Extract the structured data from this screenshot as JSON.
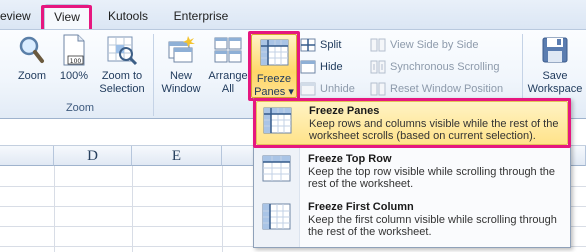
{
  "tabs": [
    {
      "label": "eview",
      "active": false
    },
    {
      "label": "View",
      "active": true
    },
    {
      "label": "Kutools",
      "active": false
    },
    {
      "label": "Enterprise",
      "active": false
    }
  ],
  "ribbon": {
    "zoom_group": {
      "label": "Zoom",
      "buttons": [
        {
          "label": "Zoom"
        },
        {
          "label": "100%"
        },
        {
          "label_line1": "Zoom to",
          "label_line2": "Selection"
        }
      ]
    },
    "window_group": {
      "new_window": {
        "label_line1": "New",
        "label_line2": "Window"
      },
      "arrange_all": {
        "label_line1": "Arrange",
        "label_line2": "All"
      },
      "freeze_panes": {
        "label_line1": "Freeze",
        "label_line2": "Panes",
        "arrow": "▾"
      },
      "split": "Split",
      "hide": "Hide",
      "unhide": "Unhide",
      "view_side_by_side": "View Side by Side",
      "synchronous_scrolling": "Synchronous Scrolling",
      "reset_window_position": "Reset Window Position",
      "save_workspace": {
        "label_line1": "Save",
        "label_line2": "Workspace"
      }
    }
  },
  "sheet": {
    "columns": [
      "D",
      "E"
    ]
  },
  "freeze_menu": {
    "items": [
      {
        "title": "Freeze Panes",
        "description": "Keep rows and columns visible while the rest of the worksheet scrolls (based on current selection).",
        "selected": true
      },
      {
        "title": "Freeze Top Row",
        "description": "Keep the top row visible while scrolling through the rest of the worksheet.",
        "selected": false
      },
      {
        "title": "Freeze First Column",
        "description": "Keep the first column visible while scrolling through the rest of the worksheet.",
        "selected": false
      }
    ]
  },
  "colors": {
    "highlight": "#e6177f",
    "menu_selected": "#ffe38a",
    "ribbon_text": "#1e395b"
  }
}
